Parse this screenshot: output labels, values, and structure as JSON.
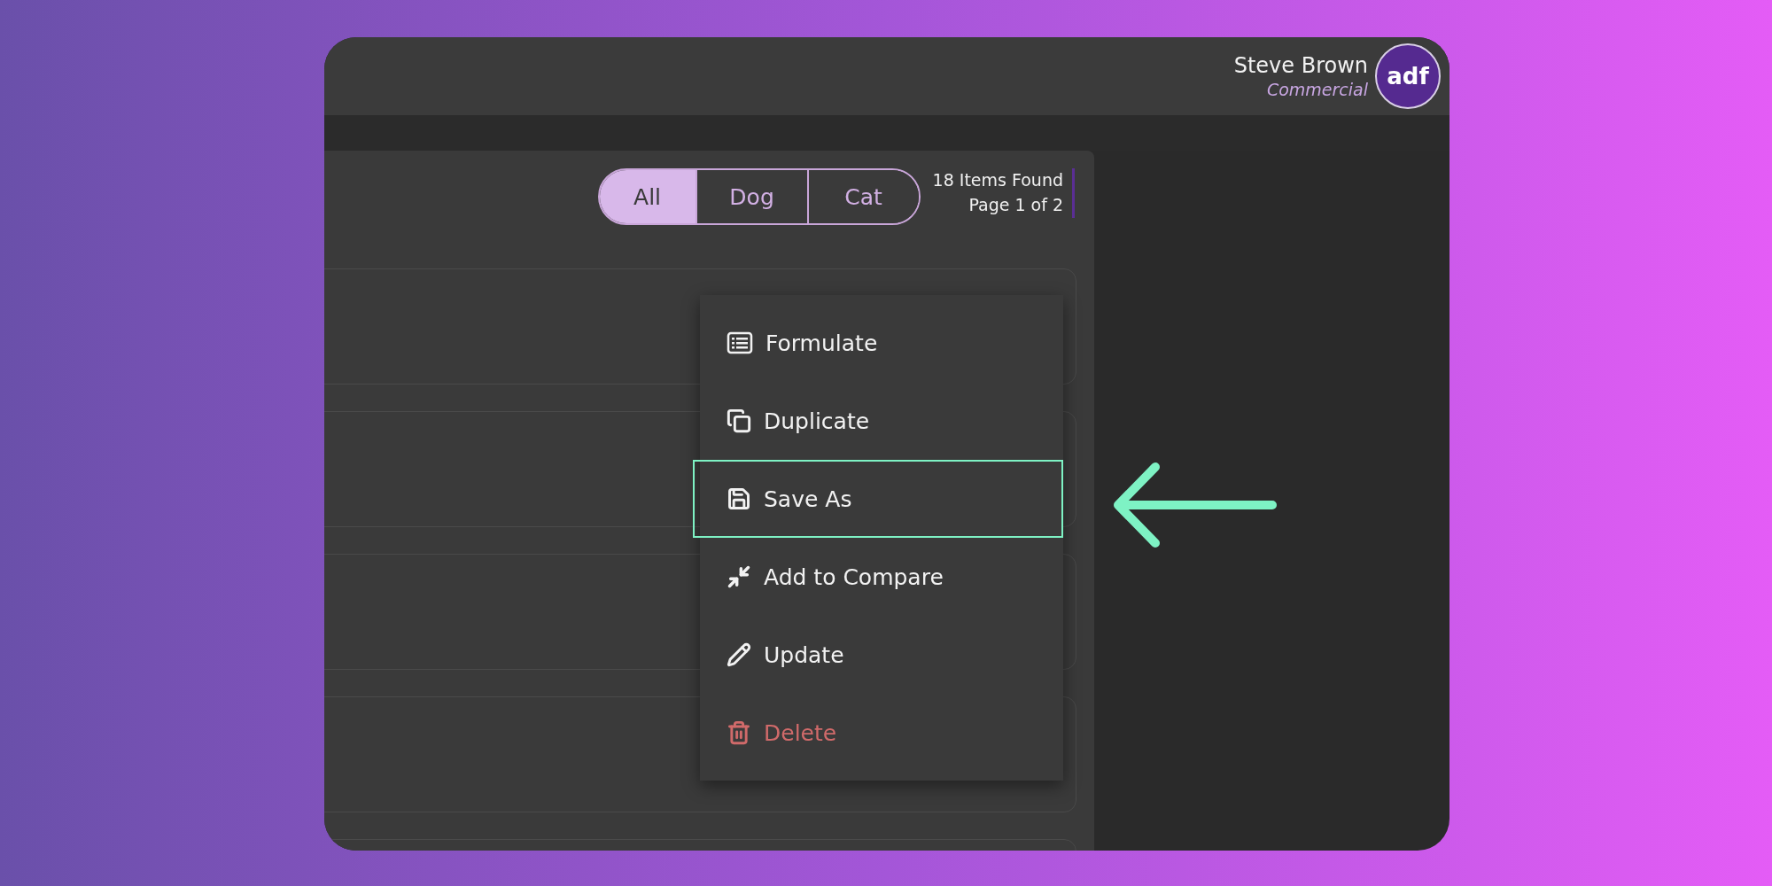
{
  "user": {
    "name": "Steve Brown",
    "role": "Commercial",
    "logo": "adf"
  },
  "filters": [
    {
      "label": "All",
      "selected": true
    },
    {
      "label": "Dog",
      "selected": false
    },
    {
      "label": "Cat",
      "selected": false
    }
  ],
  "results": {
    "count": "18 Items Found",
    "page": "Page 1 of 2"
  },
  "context_menu": [
    {
      "label": "Formulate",
      "kind": "normal",
      "highlighted": false
    },
    {
      "label": "Duplicate",
      "kind": "normal",
      "highlighted": false
    },
    {
      "label": "Save As",
      "kind": "normal",
      "highlighted": true
    },
    {
      "label": "Add to Compare",
      "kind": "normal",
      "highlighted": false
    },
    {
      "label": "Update",
      "kind": "normal",
      "highlighted": false
    },
    {
      "label": "Delete",
      "kind": "danger",
      "highlighted": false
    }
  ]
}
